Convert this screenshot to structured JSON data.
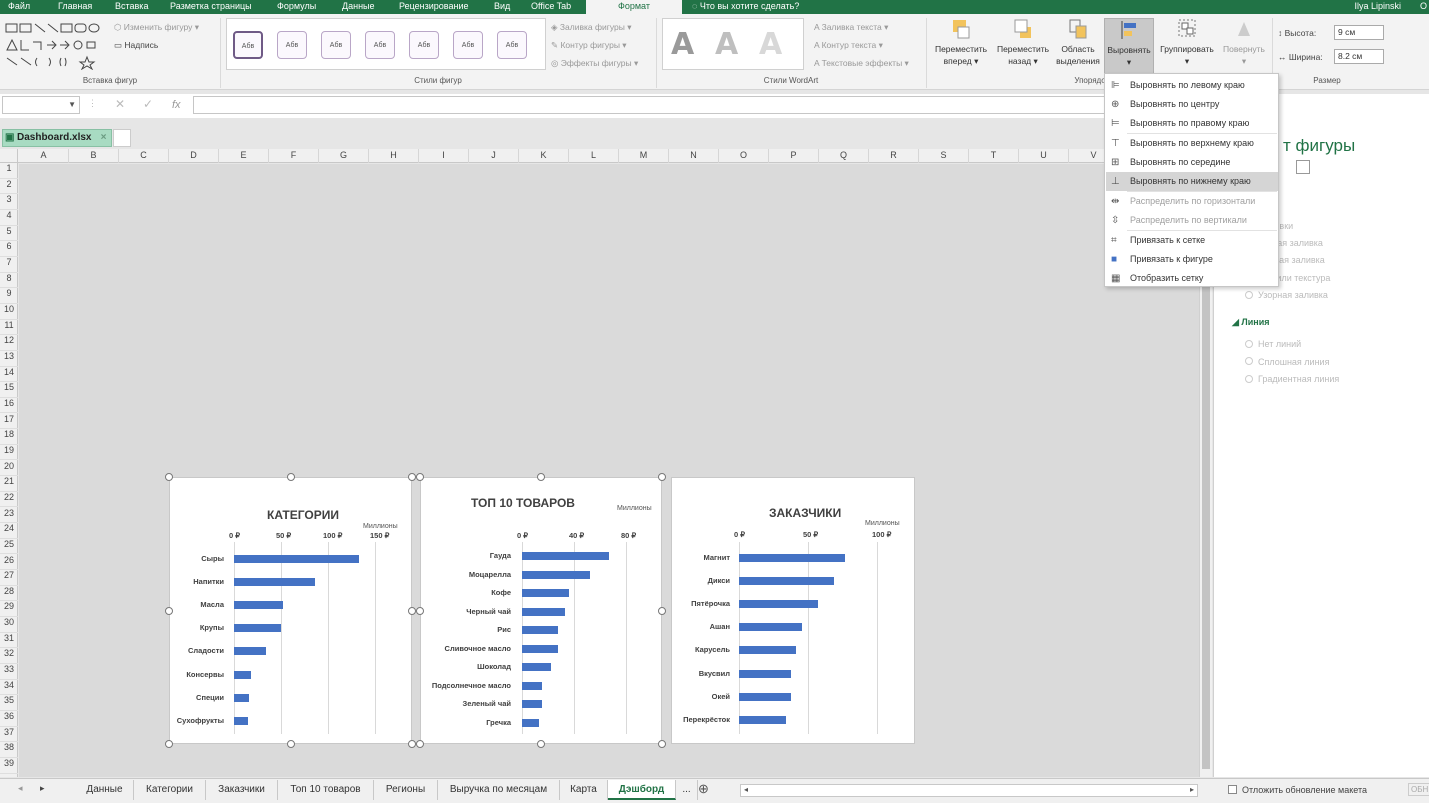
{
  "ribbon_tabs": [
    "Файл",
    "Главная",
    "Вставка",
    "Разметка страницы",
    "Формулы",
    "Данные",
    "Рецензирование",
    "Вид",
    "Office Tab",
    "Формат"
  ],
  "active_tab": "Формат",
  "tell_me": "Что вы хотите сделать?",
  "user": "Ilya Lipinski",
  "user_extra": "О",
  "insert_shapes": {
    "edit_shape": "Изменить фигуру",
    "text_box": "Надпись",
    "label": "Вставка фигур"
  },
  "shape_styles": {
    "sample": "Абв",
    "fill": "Заливка фигуры",
    "outline": "Контур фигуры",
    "effects": "Эффекты фигуры",
    "label": "Стили фигур"
  },
  "wordart": {
    "letter": "A",
    "text_fill": "Заливка текста",
    "text_outline": "Контур текста",
    "text_effects": "Текстовые эффекты",
    "label": "Стили WordArt"
  },
  "arrange": {
    "bring_forward": "Переместить",
    "bring_forward_2": "вперед",
    "send_backward": "Переместить",
    "send_backward_2": "назад",
    "selection_pane": "Область",
    "selection_pane_2": "выделения",
    "align": "Выровнять",
    "group": "Группировать",
    "rotate": "Повернуть",
    "label": "Упорядо"
  },
  "size": {
    "height_label": "Высота:",
    "height_value": "9 см",
    "width_label": "Ширина:",
    "width_value": "8.2 см",
    "label": "Размер"
  },
  "formula_bar": {
    "fx": "fx"
  },
  "document_tab": "Dashboard.xlsx",
  "columns": [
    "A",
    "B",
    "C",
    "D",
    "E",
    "F",
    "G",
    "H",
    "I",
    "J",
    "K",
    "L",
    "M",
    "N",
    "O",
    "P",
    "Q",
    "R",
    "S",
    "T",
    "U",
    "V"
  ],
  "rows": [
    "1",
    "2",
    "3",
    "4",
    "5",
    "6",
    "7",
    "8",
    "9",
    "10",
    "11",
    "12",
    "13",
    "14",
    "15",
    "16",
    "17",
    "18",
    "19",
    "20",
    "21",
    "22",
    "23",
    "24",
    "25",
    "26",
    "27",
    "28",
    "29",
    "30",
    "31",
    "32",
    "33",
    "34",
    "35",
    "36",
    "37",
    "38",
    "39"
  ],
  "align_menu": [
    {
      "label": "Выровнять по левому краю",
      "icon": "align-left-icon",
      "state": "normal"
    },
    {
      "label": "Выровнять по центру",
      "icon": "align-center-icon",
      "state": "normal"
    },
    {
      "label": "Выровнять по правому краю",
      "icon": "align-right-icon",
      "state": "normal"
    },
    {
      "label": "Выровнять по верхнему краю",
      "icon": "align-top-icon",
      "state": "normal"
    },
    {
      "label": "Выровнять по середине",
      "icon": "align-middle-icon",
      "state": "normal"
    },
    {
      "label": "Выровнять по нижнему краю",
      "icon": "align-bottom-icon",
      "state": "highlighted"
    },
    {
      "label": "Распределить по горизонтали",
      "icon": "distribute-horizontal-icon",
      "state": "disabled"
    },
    {
      "label": "Распределить по вертикали",
      "icon": "distribute-vertical-icon",
      "state": "disabled"
    },
    {
      "label": "Привязать к сетке",
      "icon": "snap-grid-icon",
      "state": "normal"
    },
    {
      "label": "Привязать к фигуре",
      "icon": "snap-shape-icon",
      "state": "normal"
    },
    {
      "label": "Отобразить сетку",
      "icon": "view-gridlines-icon",
      "state": "normal"
    }
  ],
  "format_pane": {
    "title": "т фигуры",
    "fill_options": [
      "заливки",
      "ошная заливка",
      "ентная заливка",
      "нок или текстура",
      "Узорная заливка"
    ],
    "line_section": "Линия",
    "line_options": [
      "Нет линий",
      "Сплошная линия",
      "Градиентная линия"
    ],
    "defer_update": "Отложить обновление макета",
    "update_btn": "ОБН"
  },
  "chart_data": [
    {
      "type": "bar",
      "title": "КАТЕГОРИИ",
      "unit_label": "Миллионы",
      "tick_labels": [
        "0 ₽",
        "50 ₽",
        "100 ₽",
        "150 ₽"
      ],
      "xlim": [
        0,
        150
      ],
      "categories": [
        "Сыры",
        "Напитки",
        "Масла",
        "Крупы",
        "Сладости",
        "Консервы",
        "Специи",
        "Сухофрукты"
      ],
      "values": [
        133,
        86,
        52,
        50,
        34,
        18,
        16,
        15
      ]
    },
    {
      "type": "bar",
      "title": "ТОП 10 ТОВАРОВ",
      "unit_label": "Миллионы",
      "tick_labels": [
        "0 ₽",
        "40 ₽",
        "80 ₽"
      ],
      "xlim": [
        0,
        80
      ],
      "categories": [
        "Гауда",
        "Моцарелла",
        "Кофе",
        "Черный чай",
        "Рис",
        "Сливочное масло",
        "Шоколад",
        "Подсолнечное масло",
        "Зеленый чай",
        "Гречка"
      ],
      "values": [
        67,
        52,
        36,
        33,
        28,
        28,
        22,
        15,
        15,
        13
      ]
    },
    {
      "type": "bar",
      "title": "ЗАКАЗЧИКИ",
      "unit_label": "Миллионы",
      "tick_labels": [
        "0 ₽",
        "50 ₽",
        "100 ₽"
      ],
      "xlim": [
        0,
        100
      ],
      "categories": [
        "Магнит",
        "Дикси",
        "Пятёрочка",
        "Ашан",
        "Карусель",
        "Вкусвил",
        "Окей",
        "Перекрёсток"
      ],
      "values": [
        77,
        69,
        57,
        46,
        41,
        38,
        38,
        34
      ]
    }
  ],
  "sheet_tabs": [
    "Данные",
    "Категории",
    "Заказчики",
    "Топ 10 товаров",
    "Регионы",
    "Выручка по месяцам",
    "Карта",
    "Дэшборд",
    "..."
  ],
  "active_sheet": "Дэшборд",
  "colors": {
    "excel_green": "#217346",
    "bar_blue": "#4472c4"
  }
}
